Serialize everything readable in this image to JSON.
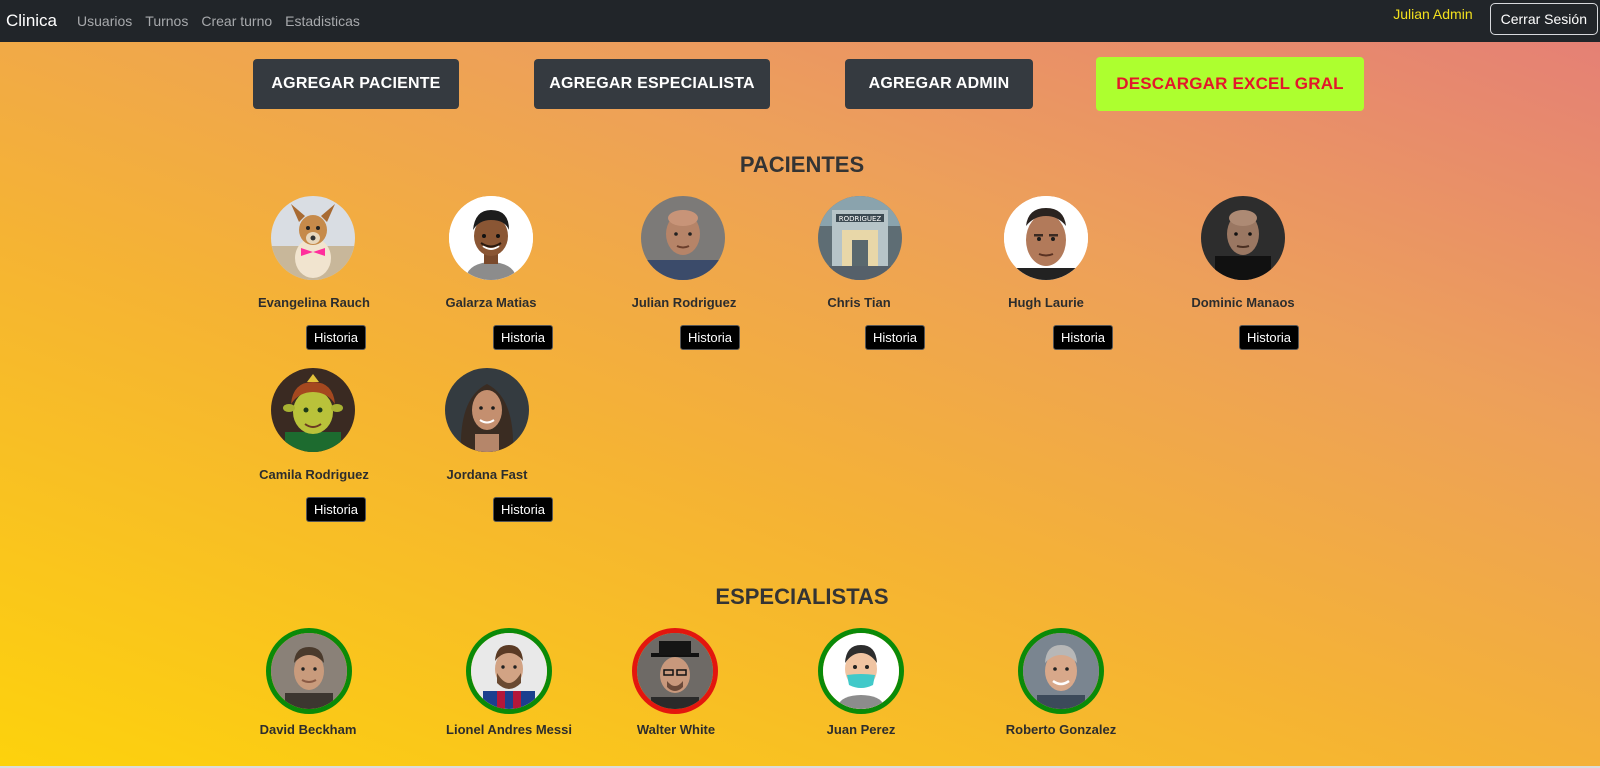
{
  "navbar": {
    "brand": "Clinica",
    "links": [
      "Usuarios",
      "Turnos",
      "Crear turno",
      "Estadisticas"
    ],
    "user": "Julian Admin",
    "logout": "Cerrar Sesión"
  },
  "actions": {
    "add_patient": "AGREGAR PACIENTE",
    "add_specialist": "AGREGAR ESPECIALISTA",
    "add_admin": "AGREGAR ADMIN",
    "download_excel": "DESCARGAR EXCEL GRAL"
  },
  "patients": {
    "title": "PACIENTES",
    "history_label": "Historia",
    "items": [
      {
        "name": "Evangelina Rauch",
        "avatar": "dog-with-bowtie"
      },
      {
        "name": "Galarza Matias",
        "avatar": "memoji-man"
      },
      {
        "name": "Julian Rodriguez",
        "avatar": "bald-man-photo"
      },
      {
        "name": "Chris Tian",
        "avatar": "clinic-building"
      },
      {
        "name": "Hugh Laurie",
        "avatar": "man-portrait"
      },
      {
        "name": "Dominic Manaos",
        "avatar": "bald-man-dark-photo"
      },
      {
        "name": "Camila Rodriguez",
        "avatar": "ogre-princess"
      },
      {
        "name": "Jordana Fast",
        "avatar": "woman-portrait"
      }
    ]
  },
  "specialists": {
    "title": "ESPECIALISTAS",
    "items": [
      {
        "name": "David Beckham",
        "status": "green"
      },
      {
        "name": "Lionel Andres Messi",
        "status": "green"
      },
      {
        "name": "Walter White",
        "status": "red"
      },
      {
        "name": "Juan Perez",
        "status": "green"
      },
      {
        "name": "Roberto Gonzalez",
        "status": "green"
      }
    ]
  },
  "colors": {
    "navbar": "#212529",
    "action_button": "#353a40",
    "excel_button": "#adff2f",
    "excel_text": "#e3172b",
    "active_border": "#0a8a08",
    "inactive_border": "#e3160e",
    "user_name": "#f2e01e"
  }
}
